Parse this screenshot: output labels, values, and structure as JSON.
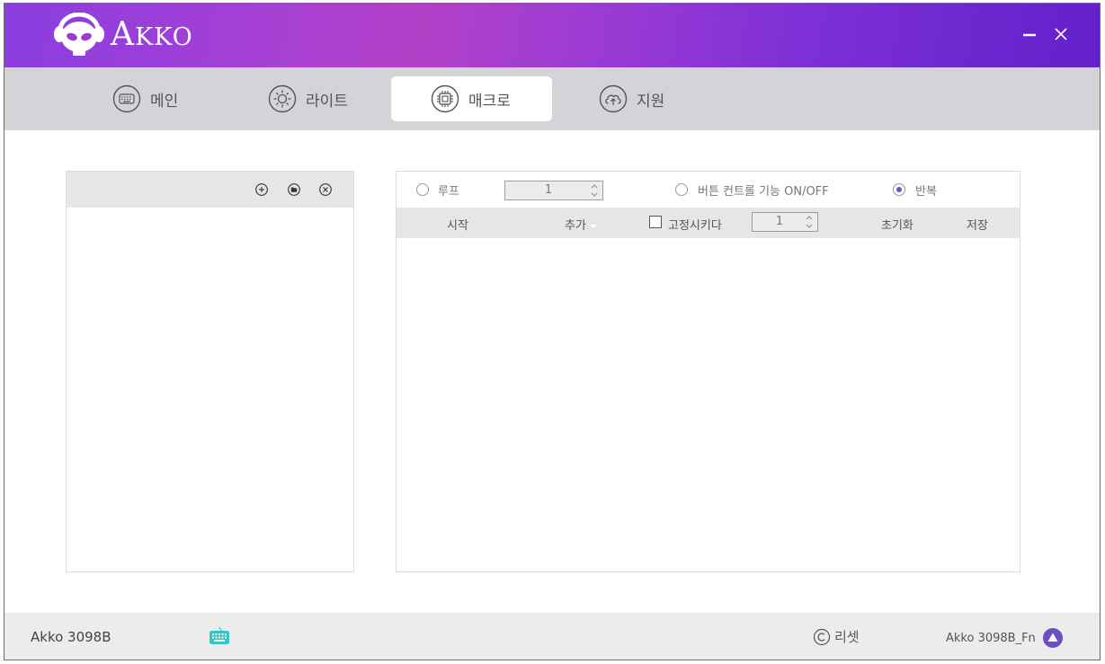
{
  "app": {
    "logo_text_big": "A",
    "logo_text_small": "KKO",
    "brand_color": "#7a2fd6",
    "accent_color": "#6f4fc8"
  },
  "tabs": [
    {
      "label": "메인",
      "icon": "keyboard-icon"
    },
    {
      "label": "라이트",
      "icon": "sun-icon"
    },
    {
      "label": "매크로",
      "icon": "chip-icon",
      "active": true
    },
    {
      "label": "지원",
      "icon": "cloud-upload-icon"
    }
  ],
  "macro_options": {
    "loop_label": "루프",
    "loop_count": "1",
    "button_control_label": "버튼 컨트롤 기능 ON/OFF",
    "repeat_label": "반복",
    "selected": "반복"
  },
  "macro_header": {
    "start_label": "시작",
    "add_label": "추가",
    "fixed_label": "고정시키다",
    "fixed_value": "1",
    "reset_label": "초기화",
    "save_label": "저장"
  },
  "footer": {
    "device_name": "Akko 3098B",
    "reset_label": "리셋",
    "profile_name": "Akko 3098B_Fn"
  }
}
